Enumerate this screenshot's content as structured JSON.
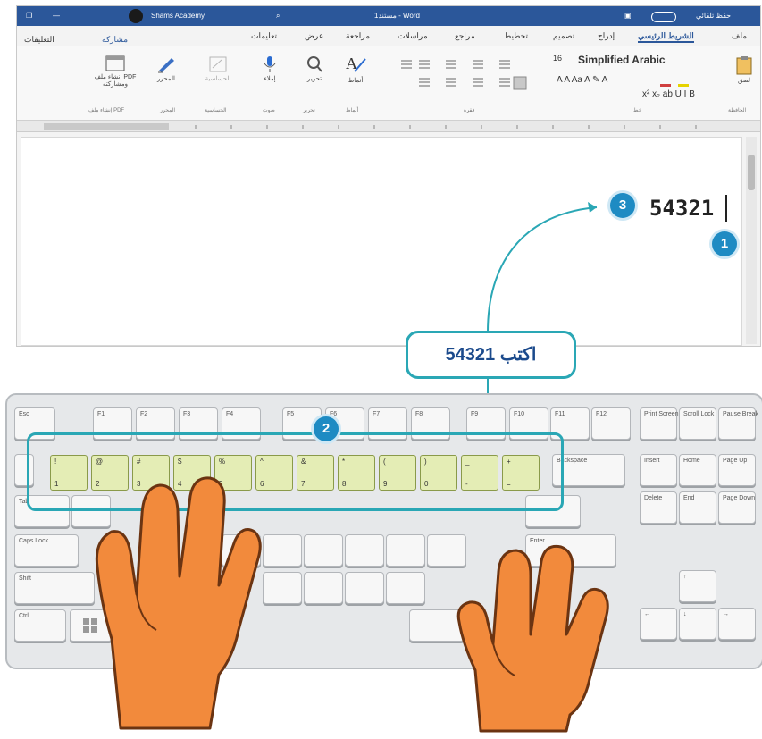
{
  "titlebar": {
    "autosave": "حفظ تلقائي",
    "doc_title": "مستند1 - Word",
    "search": "بحث",
    "account": "Shams Academy"
  },
  "tabs": [
    "ملف",
    "الشريط الرئيسي",
    "إدراج",
    "تصميم",
    "تخطيط",
    "مراجع",
    "مراسلات",
    "مراجعة",
    "عرض",
    "تعليمات"
  ],
  "share_label": "مشاركة",
  "comments_label": "التعليقات",
  "ribbon": {
    "font_name": "Simplified Arabic",
    "font_size": "16",
    "groups": {
      "clipboard": "الحافظة",
      "font": "خط",
      "paragraph": "فقرة",
      "styles": "أنماط",
      "editing": "تحرير",
      "voice": "صوت",
      "sensitivity": "الحساسية",
      "editor": "المحرر",
      "pdf": "إنشاء ملف PDF"
    },
    "buttons": {
      "paste": "لصق",
      "styles": "أنماط",
      "editing": "تحرير",
      "dictate": "إملاء",
      "sensitivity": "الحساسية",
      "editor": "المحرر",
      "pdf": "إنشاء ملف PDF ومشاركته"
    }
  },
  "document": {
    "typed_text": "54321"
  },
  "callouts": {
    "one": "1",
    "two": "2",
    "three": "3",
    "instruction": "اكتب 54321"
  },
  "keyboard": {
    "fn_row": [
      "Esc",
      "F1",
      "F2",
      "F3",
      "F4",
      "F5",
      "F6",
      "F7",
      "F8",
      "F9",
      "F10",
      "F11",
      "F12"
    ],
    "sys_keys": [
      "Print Screen",
      "Scroll Lock",
      "Pause Break"
    ],
    "nav_keys": [
      "Insert",
      "Home",
      "Page Up",
      "Delete",
      "End",
      "Page Down"
    ],
    "number_keys": [
      {
        "top": "!",
        "bottom": "1"
      },
      {
        "top": "@",
        "bottom": "2"
      },
      {
        "top": "#",
        "bottom": "3"
      },
      {
        "top": "$",
        "bottom": "4"
      },
      {
        "top": "%",
        "bottom": "5"
      },
      {
        "top": "^",
        "bottom": "6"
      },
      {
        "top": "&",
        "bottom": "7"
      },
      {
        "top": "*",
        "bottom": "8"
      },
      {
        "top": "(",
        "bottom": "9"
      },
      {
        "top": ")",
        "bottom": "0"
      },
      {
        "top": "_",
        "bottom": "-"
      },
      {
        "top": "+",
        "bottom": "="
      }
    ],
    "backspace": "Backspace",
    "tab": "Tab",
    "caps": "Caps Lock",
    "shift": "Shift",
    "enter": "Enter",
    "ctrl": "Ctrl"
  },
  "colors": {
    "accent": "#2aa7b5",
    "badge": "#1e8bc3",
    "word_blue": "#2b579a",
    "hand": "#f28a3c",
    "number_key": "#e4edb5"
  }
}
